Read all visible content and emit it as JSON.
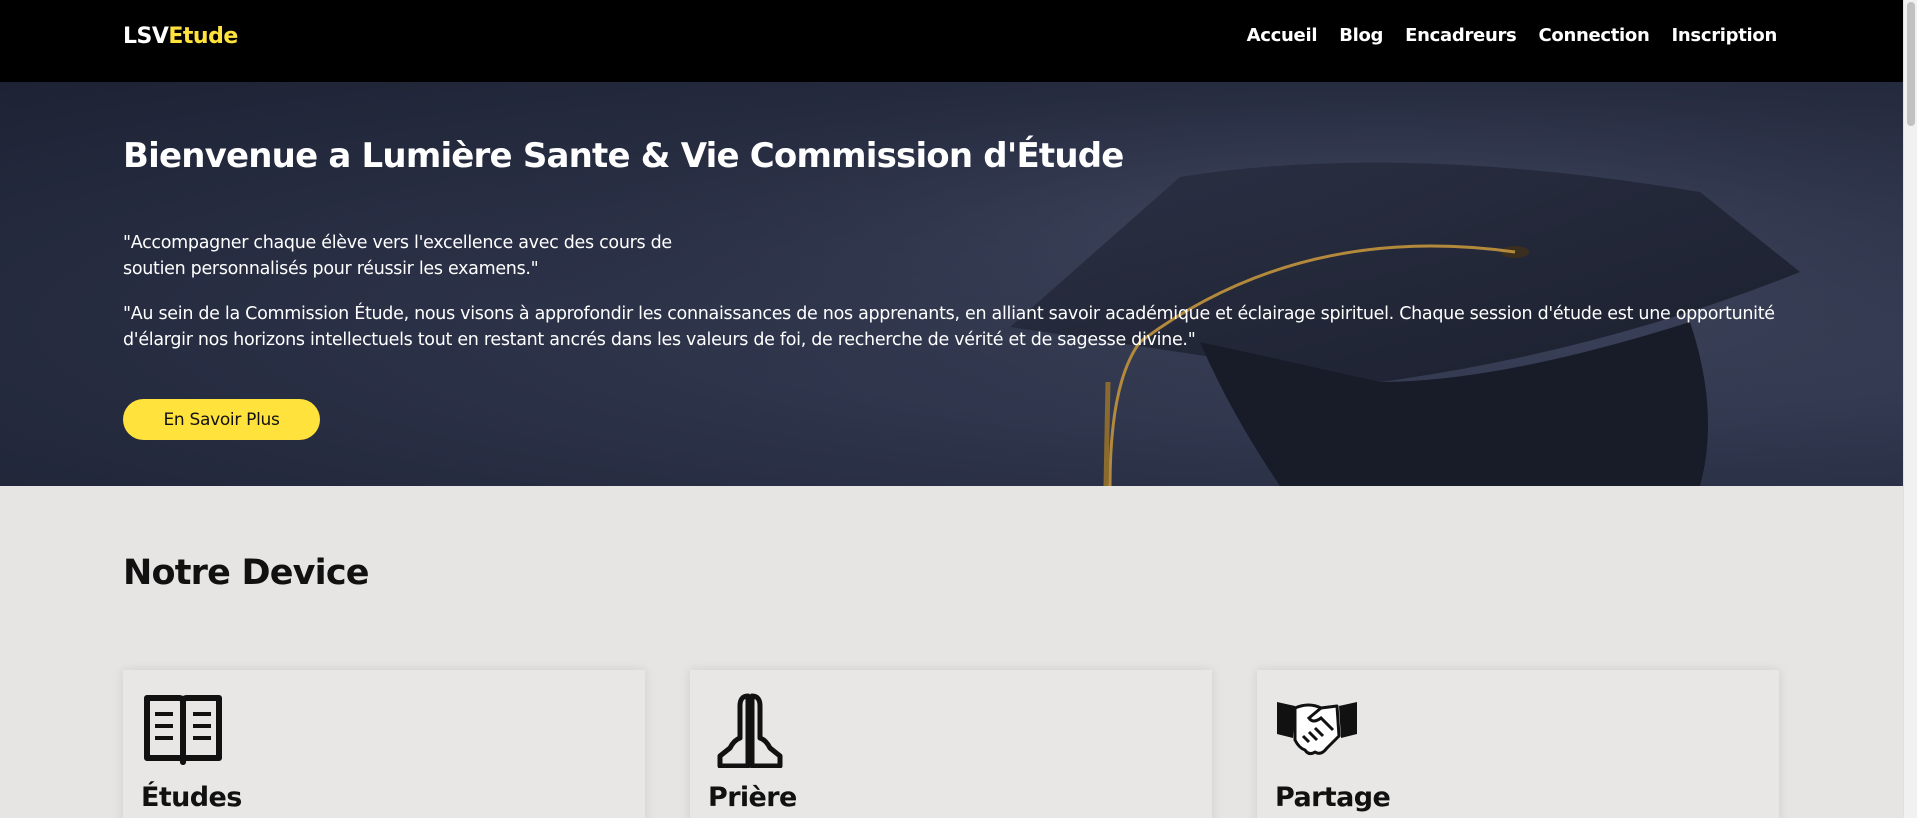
{
  "brand": {
    "prefix": "LSV",
    "accent": "Etude"
  },
  "nav": {
    "items": [
      {
        "label": "Accueil"
      },
      {
        "label": "Blog"
      },
      {
        "label": "Encadreurs"
      },
      {
        "label": "Connection"
      },
      {
        "label": "Inscription"
      }
    ]
  },
  "hero": {
    "title": "Bienvenue a Lumière Sante & Vie Commission d'Étude",
    "tagline": "\"Accompagner chaque élève vers l'excellence avec des cours de soutien personnalisés pour réussir les examens.\"",
    "description": "\"Au sein de la Commission Étude, nous visons à approfondir les connaissances de nos apprenants, en alliant savoir académique et éclairage spirituel. Chaque session d'étude est une opportunité d'élargir nos horizons intellectuels tout en restant ancrés dans les valeurs de foi, de recherche de vérité et de sagesse divine.\"",
    "cta_label": "En Savoir Plus"
  },
  "section": {
    "title": "Notre Device"
  },
  "cards": [
    {
      "title": "Études",
      "icon": "open-book-icon"
    },
    {
      "title": "Prière",
      "icon": "praying-hands-icon"
    },
    {
      "title": "Partage",
      "icon": "handshake-icon"
    }
  ],
  "colors": {
    "accent": "#ffe23c",
    "navbar": "#000000",
    "page_bg": "#e6e5e3",
    "hero_bg": "#2c3248"
  }
}
